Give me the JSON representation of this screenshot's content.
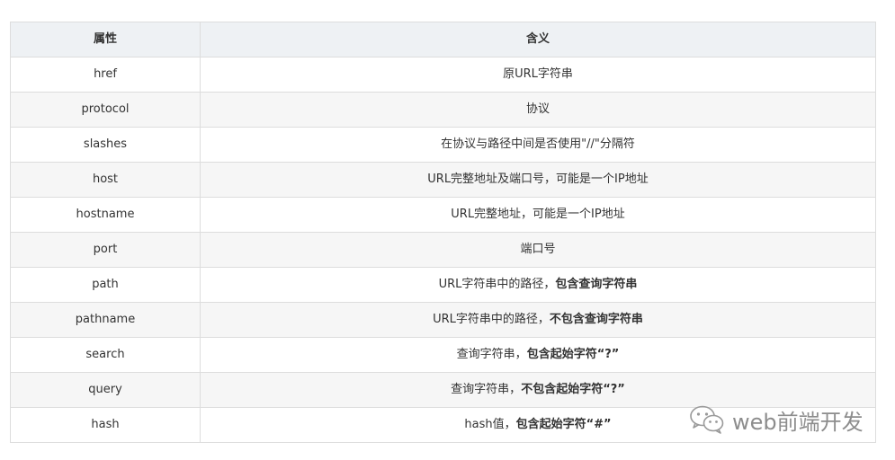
{
  "table": {
    "headers": [
      "属性",
      "含义"
    ],
    "rows": [
      {
        "attr": "href",
        "meaning": [
          {
            "t": "原URL字符串",
            "b": false
          }
        ]
      },
      {
        "attr": "protocol",
        "meaning": [
          {
            "t": "协议",
            "b": false
          }
        ]
      },
      {
        "attr": "slashes",
        "meaning": [
          {
            "t": "在协议与路径中间是否使用\"//\"分隔符",
            "b": false
          }
        ]
      },
      {
        "attr": "host",
        "meaning": [
          {
            "t": "URL完整地址及端口号，可能是一个IP地址",
            "b": false
          }
        ]
      },
      {
        "attr": "hostname",
        "meaning": [
          {
            "t": "URL完整地址，可能是一个IP地址",
            "b": false
          }
        ]
      },
      {
        "attr": "port",
        "meaning": [
          {
            "t": "端口号",
            "b": false
          }
        ]
      },
      {
        "attr": "path",
        "meaning": [
          {
            "t": "URL字符串中的路径，",
            "b": false
          },
          {
            "t": "包含查询字符串",
            "b": true
          }
        ]
      },
      {
        "attr": "pathname",
        "meaning": [
          {
            "t": "URL字符串中的路径，",
            "b": false
          },
          {
            "t": "不包含查询字符串",
            "b": true
          }
        ]
      },
      {
        "attr": "search",
        "meaning": [
          {
            "t": "查询字符串，",
            "b": false
          },
          {
            "t": "包含起始字符“?”",
            "b": true
          }
        ]
      },
      {
        "attr": "query",
        "meaning": [
          {
            "t": "查询字符串，",
            "b": false
          },
          {
            "t": "不包含起始字符“?”",
            "b": true
          }
        ]
      },
      {
        "attr": "hash",
        "meaning": [
          {
            "t": "hash值，",
            "b": false
          },
          {
            "t": "包含起始字符“#”",
            "b": true
          }
        ]
      }
    ]
  },
  "watermark": {
    "icon": "wechat-icon",
    "text": "web前端开发"
  }
}
